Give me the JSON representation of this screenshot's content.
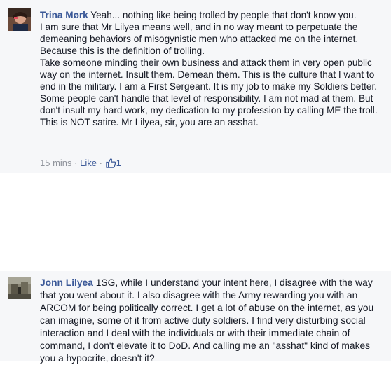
{
  "comments": [
    {
      "author": "Trina Mørk",
      "paragraphs": [
        "Yeah... nothing like being trolled by people that don't know you.",
        "I am sure that Mr Lilyea means well, and in no way meant to perpetuate the demeaning behaviors of misogynistic men who attacked me on the internet. Because this is the definition of trolling.",
        "Take someone minding their own business and attack them in very open public way on the internet. Insult them. Demean them. This is the culture that I want to end in the military. I am a First Sergeant. It is my job to make my Soldiers better. Some people can't handle that level of responsibility. I am not mad at them. But don't insult my hard work, my dedication to my profession by calling ME the troll.",
        "This is NOT satire. Mr Lilyea, sir, you are an asshat."
      ],
      "meta": {
        "time": "15 mins",
        "separator": "·",
        "like_label": "Like",
        "like_count": "1"
      }
    },
    {
      "author": "Jonn Lilyea",
      "paragraphs": [
        "1SG, while I understand your intent here, I disagree with the way that you went about it. I also disagree with the Army rewarding you with an ARCOM for being politically correct. I get a lot of abuse on the internet, as you can imagine, some of it from active duty soldiers. I find very disturbing social interaction and I deal with the individuals or with their immediate chain of command, I don't elevate it to DoD. And calling me an \"asshat\" kind of makes you a hypocrite, doesn't it?"
      ]
    }
  ],
  "colors": {
    "author_link": "#3b5998",
    "body_text": "#141823",
    "meta_text": "#90949c",
    "comment_bg": "#f6f7f9"
  },
  "icons": {
    "like": "thumbs-up-icon"
  }
}
